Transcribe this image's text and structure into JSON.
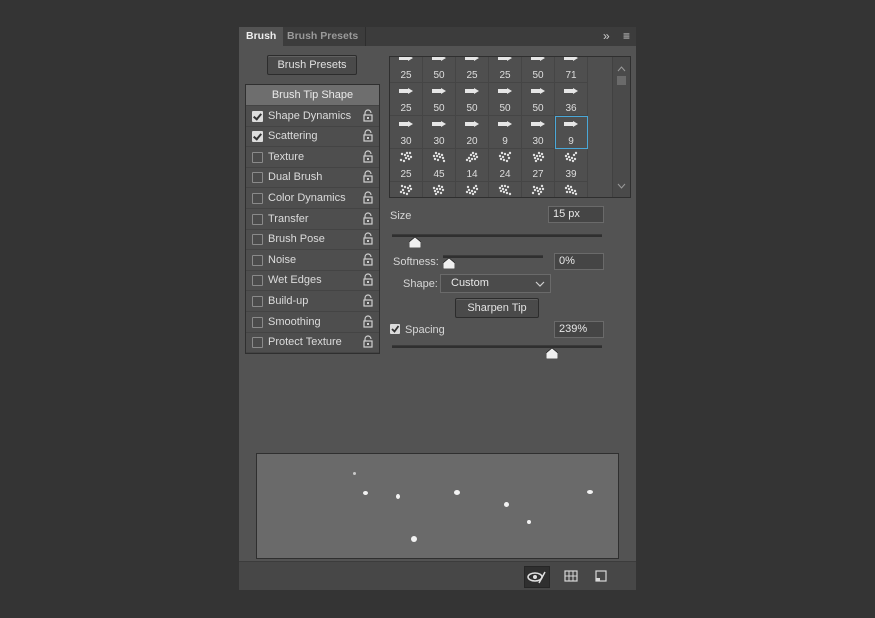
{
  "tabs": [
    "Brush",
    "Brush Presets"
  ],
  "presets_button": "Brush Presets",
  "options": [
    {
      "label": "Brush Tip Shape",
      "checked": null
    },
    {
      "label": "Shape Dynamics",
      "checked": true
    },
    {
      "label": "Scattering",
      "checked": true
    },
    {
      "label": "Texture",
      "checked": false
    },
    {
      "label": "Dual Brush",
      "checked": false
    },
    {
      "label": "Color Dynamics",
      "checked": false
    },
    {
      "label": "Transfer",
      "checked": false
    },
    {
      "label": "Brush Pose",
      "checked": false
    },
    {
      "label": "Noise",
      "checked": false
    },
    {
      "label": "Wet Edges",
      "checked": false
    },
    {
      "label": "Build-up",
      "checked": false
    },
    {
      "label": "Smoothing",
      "checked": false
    },
    {
      "label": "Protect Texture",
      "checked": false
    }
  ],
  "brush_grid": [
    [
      "25",
      "50",
      "25",
      "25",
      "50",
      "71"
    ],
    [
      "25",
      "50",
      "50",
      "50",
      "50",
      "36"
    ],
    [
      "30",
      "30",
      "20",
      "9",
      "30",
      "9"
    ],
    [
      "25",
      "45",
      "14",
      "24",
      "27",
      "39"
    ],
    [
      "",
      "",
      "",
      "",
      "",
      ""
    ]
  ],
  "selected_brush": {
    "row": 2,
    "col": 5
  },
  "size": {
    "label": "Size",
    "value": "15 px",
    "level": 0.11
  },
  "softness": {
    "label": "Softness:",
    "value": "0%",
    "level": 0
  },
  "shape": {
    "label": "Shape:",
    "value": "Custom"
  },
  "sharpen_button": "Sharpen Tip",
  "spacing": {
    "label": "Spacing",
    "value": "239%",
    "checked": true,
    "level": 0.76
  },
  "icons": {
    "expand": "double-chevron-right-icon",
    "menu": "hamburger-icon",
    "lock": "lock-icon",
    "footer": [
      "toggle-live-tip-icon",
      "brush-grid-icon",
      "new-preset-icon"
    ]
  },
  "colors": {
    "panel": "#535353",
    "accent": "#4aa8d8",
    "background": "#343434"
  }
}
